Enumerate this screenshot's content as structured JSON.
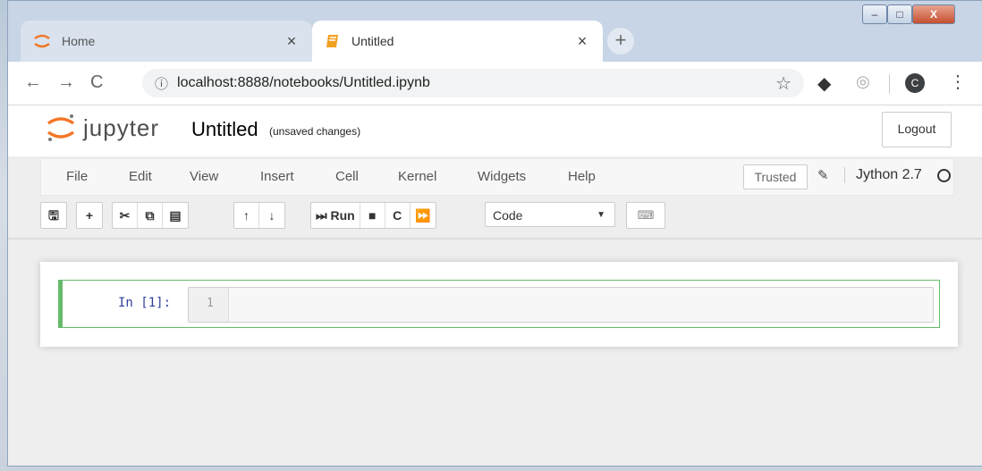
{
  "browser": {
    "tabs": [
      {
        "title": "Home",
        "icon": "jupyter-logo-icon",
        "active": false
      },
      {
        "title": "Untitled",
        "icon": "notebook-icon",
        "active": true
      }
    ],
    "new_tab": "+",
    "window_controls": {
      "minimize": "–",
      "maximize": "□",
      "close": "X"
    },
    "address": {
      "url": "localhost:8888/notebooks/Untitled.ipynb"
    },
    "profile_initial": "C"
  },
  "jupyter": {
    "logo_text": "jupyter",
    "notebook_name": "Untitled",
    "save_status": "(unsaved changes)",
    "logout_label": "Logout",
    "menu": [
      "File",
      "Edit",
      "View",
      "Insert",
      "Cell",
      "Kernel",
      "Widgets",
      "Help"
    ],
    "trusted_label": "Trusted",
    "kernel_name": "Jython 2.7",
    "toolbar": {
      "run_label": "Run",
      "cell_type": "Code"
    },
    "cell": {
      "prompt": "In [1]:",
      "line_number": "1",
      "content": ""
    }
  },
  "colors": {
    "accent": "#f37726",
    "cell_border": "#66bb6a",
    "prompt": "#303f9f"
  }
}
